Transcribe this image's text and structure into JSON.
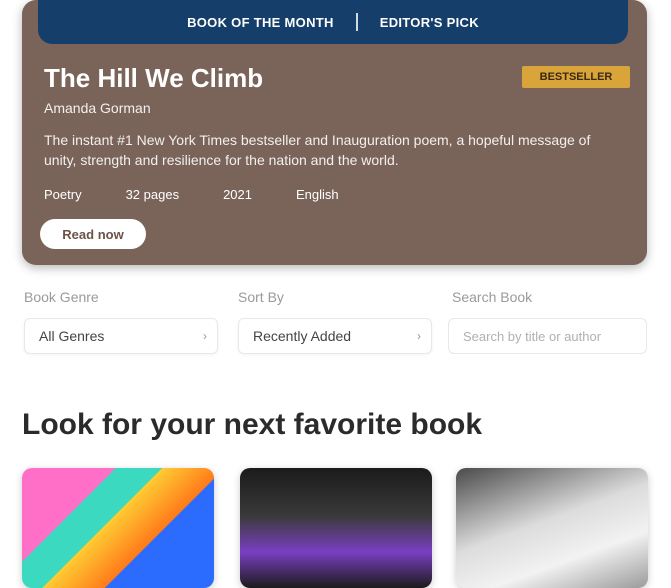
{
  "hero": {
    "banner_left": "BOOK OF THE MONTH",
    "banner_right": "EDITOR'S PICK",
    "title": "The Hill We Climb",
    "badge": "BESTSELLER",
    "author": "Amanda Gorman",
    "description": "The instant #1 New York Times bestseller and Inauguration poem, a hopeful message of unity, strength and resilience for the nation and the world.",
    "meta": [
      "Poetry",
      "32 pages",
      "2021",
      "English"
    ],
    "button_label": "Read now"
  },
  "filters": {
    "category_label": "Book Genre",
    "category_value": "All Genres",
    "sort_label": "Sort By",
    "sort_value": "Recently Added",
    "search_label": "Search Book",
    "search_placeholder": "Search by title or author"
  },
  "section": {
    "title": "Look for your next favorite book"
  }
}
